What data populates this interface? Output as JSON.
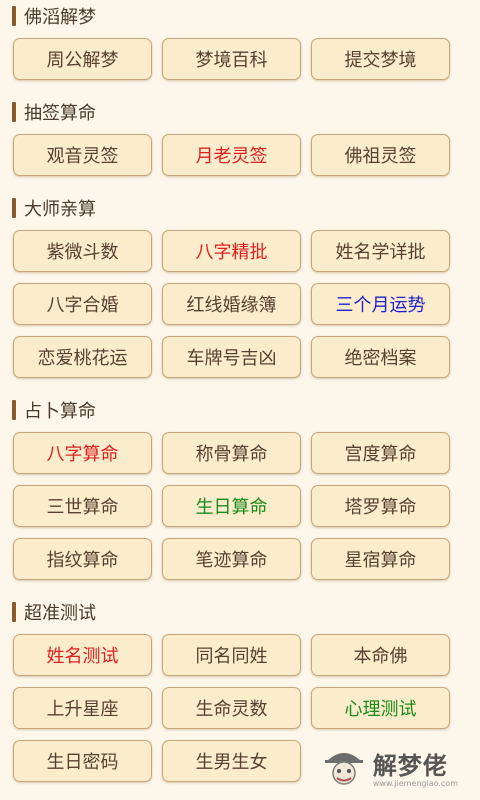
{
  "sections": [
    {
      "title": "佛滔解梦",
      "buttons": [
        {
          "label": "周公解梦"
        },
        {
          "label": "梦境百科"
        },
        {
          "label": "提交梦境"
        }
      ]
    },
    {
      "title": "抽签算命",
      "buttons": [
        {
          "label": "观音灵签"
        },
        {
          "label": "月老灵签",
          "color": "#e02020"
        },
        {
          "label": "佛祖灵签"
        }
      ]
    },
    {
      "title": "大师亲算",
      "buttons": [
        {
          "label": "紫微斗数"
        },
        {
          "label": "八字精批",
          "color": "#e02020"
        },
        {
          "label": "姓名学详批"
        },
        {
          "label": "八字合婚"
        },
        {
          "label": "红线婚缘簿"
        },
        {
          "label": "三个月运势",
          "color": "#2020cc"
        },
        {
          "label": "恋爱桃花运"
        },
        {
          "label": "车牌号吉凶"
        },
        {
          "label": "绝密档案"
        }
      ]
    },
    {
      "title": "占卜算命",
      "buttons": [
        {
          "label": "八字算命",
          "color": "#e02020"
        },
        {
          "label": "称骨算命"
        },
        {
          "label": "宫度算命"
        },
        {
          "label": "三世算命"
        },
        {
          "label": "生日算命",
          "color": "#1a8a1a"
        },
        {
          "label": "塔罗算命"
        },
        {
          "label": "指纹算命"
        },
        {
          "label": "笔迹算命"
        },
        {
          "label": "星宿算命"
        }
      ]
    },
    {
      "title": "超准测试",
      "buttons": [
        {
          "label": "姓名测试",
          "color": "#e02020"
        },
        {
          "label": "同名同姓"
        },
        {
          "label": "本命佛"
        },
        {
          "label": "上升星座"
        },
        {
          "label": "生命灵数"
        },
        {
          "label": "心理测试",
          "color": "#1a8a1a"
        },
        {
          "label": "生日密码"
        },
        {
          "label": "生男生女"
        }
      ]
    }
  ],
  "watermark": {
    "title": "解梦佬",
    "url": "www.jiemenglao.com"
  }
}
